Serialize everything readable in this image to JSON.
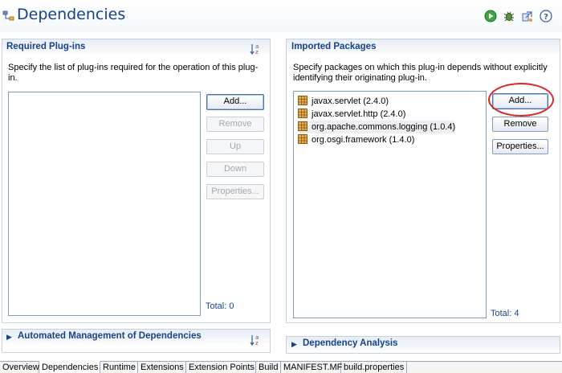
{
  "header": {
    "title": "Dependencies",
    "icons": [
      "dependencies-page-icon",
      "run-icon",
      "debug-icon",
      "export-icon",
      "help-icon"
    ]
  },
  "required_plugins": {
    "title": "Required Plug-ins",
    "description_line1": "Specify the list of plug-ins required for the operation of this plug-",
    "description_line2": "in.",
    "buttons": {
      "add": "Add...",
      "remove": "Remove",
      "up": "Up",
      "down": "Down",
      "properties": "Properties..."
    },
    "items": [],
    "total": "Total: 0"
  },
  "imported_packages": {
    "title": "Imported Packages",
    "description_line1": "Specify packages on which this plug-in depends without explicitly",
    "description_line2": "identifying their originating plug-in.",
    "buttons": {
      "add": "Add...",
      "remove": "Remove",
      "properties": "Properties..."
    },
    "items": [
      {
        "label": "javax.servlet (2.4.0)"
      },
      {
        "label": "javax.servlet.http (2.4.0)"
      },
      {
        "label": "org.apache.commons.logging (1.0.4)"
      },
      {
        "label": "org.osgi.framework (1.4.0)"
      }
    ],
    "selected_index": 2,
    "total": "Total: 4"
  },
  "automated_management": {
    "title": "Automated Management of Dependencies"
  },
  "dependency_analysis": {
    "title": "Dependency Analysis"
  },
  "tabs": [
    {
      "label": "Overview"
    },
    {
      "label": "Dependencies",
      "active": true
    },
    {
      "label": "Runtime"
    },
    {
      "label": "Extensions"
    },
    {
      "label": "Extension Points"
    },
    {
      "label": "Build"
    },
    {
      "label": "MANIFEST.MF"
    },
    {
      "label": "build.properties"
    }
  ],
  "colors": {
    "title_blue": "#15428b",
    "section_border": "#c4d1e0",
    "highlight_ellipse": "#d82828"
  }
}
